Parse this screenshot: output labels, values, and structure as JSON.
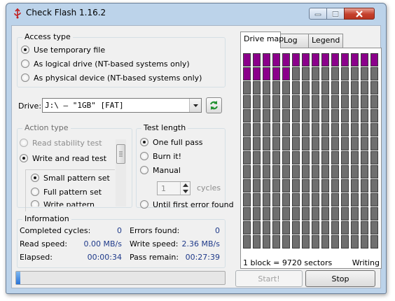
{
  "window": {
    "title": "Check Flash 1.16.2"
  },
  "access_type": {
    "title": "Access type",
    "options": [
      {
        "label": "Use temporary file",
        "checked": true
      },
      {
        "label": "As logical drive (NT-based systems only)",
        "checked": false
      },
      {
        "label": "As physical device (NT-based systems only)",
        "checked": false
      }
    ]
  },
  "drive": {
    "label": "Drive:",
    "value": "J:\\ – \"1GB\" [FAT]"
  },
  "action_type": {
    "title": "Action type",
    "options": [
      {
        "label": "Read stability test",
        "checked": false,
        "disabled": true
      },
      {
        "label": "Write and read test",
        "checked": true,
        "disabled": false
      }
    ],
    "patterns": [
      {
        "label": "Small pattern set",
        "checked": true
      },
      {
        "label": "Full pattern set",
        "checked": false
      },
      {
        "label": "Write pattern",
        "checked": false
      }
    ]
  },
  "test_length": {
    "title": "Test length",
    "options": [
      {
        "label": "One full pass",
        "checked": true
      },
      {
        "label": "Burn it!",
        "checked": false
      },
      {
        "label": "Manual",
        "checked": false
      },
      {
        "label": "Until first error found",
        "checked": false
      }
    ],
    "cycles_value": "1",
    "cycles_label": "cycles"
  },
  "information": {
    "title": "Information",
    "rows": [
      {
        "label1": "Completed cycles:",
        "value1": "0",
        "label2": "Errors found:",
        "value2": "0"
      },
      {
        "label1": "Read speed:",
        "value1": "0.00 MB/s",
        "label2": "Write speed:",
        "value2": "2.36 MB/s"
      },
      {
        "label1": "Elapsed:",
        "value1": "00:00:34",
        "label2": "Pass remain:",
        "value2": "00:27:39"
      }
    ]
  },
  "tabs": [
    {
      "label": "Drive map",
      "active": true
    },
    {
      "label": "Log",
      "active": false
    },
    {
      "label": "Legend",
      "active": false
    }
  ],
  "drive_map": {
    "columns": 14,
    "rows": 14,
    "written_blocks": 19,
    "block_info": "1 block = 9720 sectors",
    "status": "Writing",
    "colors": {
      "written": "#8b008b",
      "pending": "#6f6f6f"
    }
  },
  "progress": {
    "fraction": 0.02,
    "color": "#2a74d8"
  },
  "buttons": {
    "start": "Start!",
    "stop": "Stop"
  }
}
